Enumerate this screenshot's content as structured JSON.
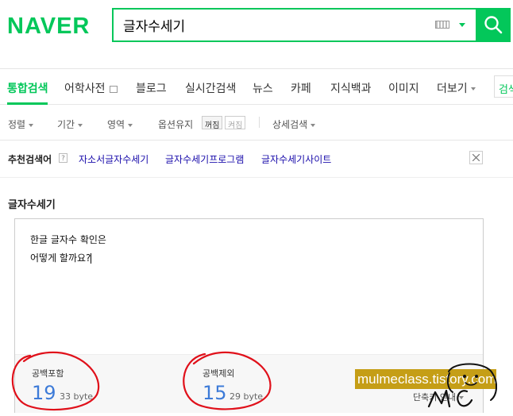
{
  "header": {
    "logo": "NAVER",
    "query": "글자수세기",
    "search_button": "search"
  },
  "tabs": [
    {
      "label": "통합검색",
      "active": true
    },
    {
      "label": "어학사전"
    },
    {
      "label": "블로그"
    },
    {
      "label": "실시간검색"
    },
    {
      "label": "뉴스"
    },
    {
      "label": "카페"
    },
    {
      "label": "지식백과"
    },
    {
      "label": "이미지"
    },
    {
      "label": "더보기"
    }
  ],
  "tab_extra": "검색",
  "filters": {
    "sort": "정렬",
    "period": "기간",
    "area": "영역",
    "option_keep": "옵션유지",
    "off": "꺼짐",
    "on": "켜짐",
    "detail": "상세검색"
  },
  "related": {
    "label": "추천검색어",
    "help": "?",
    "items": [
      "자소서글자수세기",
      "글자수세기프로그램",
      "글자수세기사이트"
    ]
  },
  "widget": {
    "title": "글자수세기",
    "text_lines": [
      "한글 글자수 확인은",
      "어떻게 할까요?"
    ],
    "with_spaces": {
      "label": "공백포함",
      "chars": "19",
      "bytes": "33 byte"
    },
    "without_spaces": {
      "label": "공백제외",
      "chars": "15",
      "bytes": "29 byte"
    },
    "unit_button": "단축키 안내"
  },
  "watermark": {
    "text": "mulmeclass.tistory.com",
    "signature": "Mc"
  },
  "colors": {
    "brand": "#03c75a",
    "count": "#3d7bd8",
    "annotation": "#e0101a",
    "watermark": "#c59e16"
  }
}
